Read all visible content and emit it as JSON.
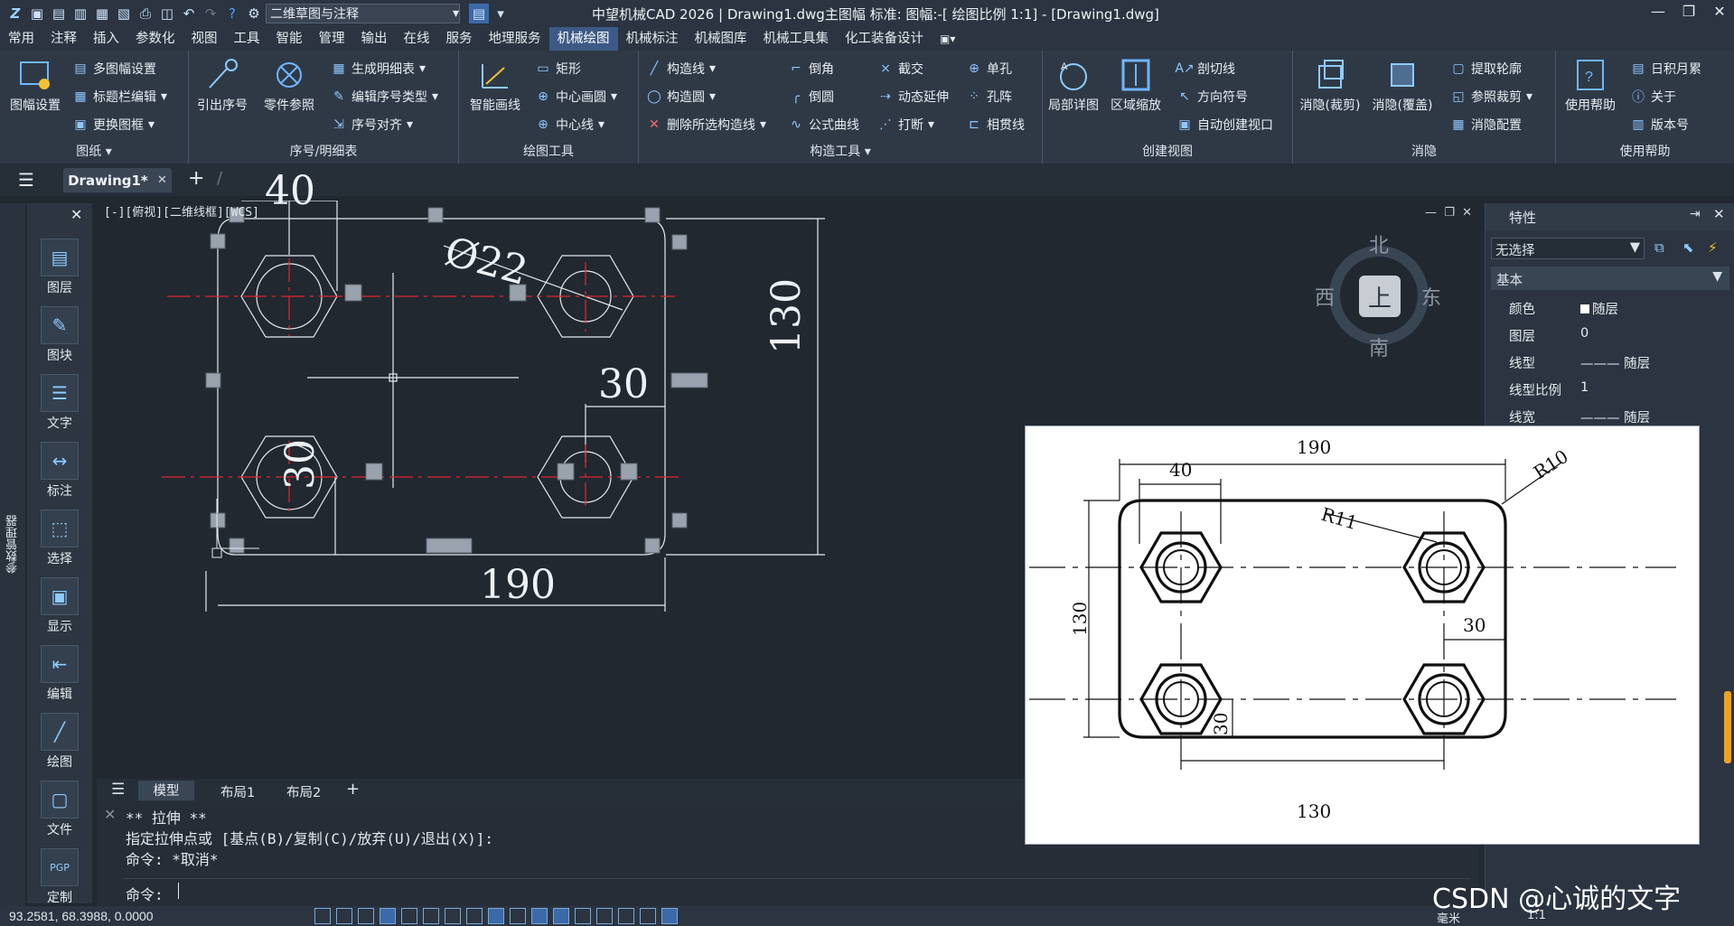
{
  "titlebar": {
    "workspace": "二维草图与注释",
    "app_title": "中望机械CAD 2026 | Drawing1.dwg主图幅  标准: 图幅:-[ 绘图比例 1:1] - [Drawing1.dwg]"
  },
  "menubar": [
    "常用",
    "注释",
    "插入",
    "参数化",
    "视图",
    "工具",
    "智能",
    "管理",
    "输出",
    "在线",
    "服务",
    "地理服务",
    "机械绘图",
    "机械标注",
    "机械图库",
    "机械工具集",
    "化工装备设计"
  ],
  "menubar_active": "机械绘图",
  "ribbon": {
    "panels": {
      "paper": "图纸",
      "seq": "序号/明细表",
      "draw": "绘图工具",
      "construct": "构造工具",
      "view": "创建视图",
      "hide": "消隐",
      "help": "使用帮助"
    },
    "buttons": {
      "paper_setup": "图幅设置",
      "multi_paper": "多图幅设置",
      "title_edit": "标题栏编辑",
      "change_frame": "更换图框",
      "lead_seq": "引出序号",
      "part_ref": "零件参照",
      "gen_bom": "生成明细表",
      "edit_seq_type": "编辑序号类型",
      "seq_align": "序号对齐",
      "smart_line": "智能画线",
      "rect": "矩形",
      "center_circle": "中心画圆",
      "center_line": "中心线",
      "cline": "构造线",
      "ccircle": "构造圆",
      "del_cline": "删除所选构造线",
      "chamfer": "倒角",
      "fillet": "倒圆",
      "formula_curve": "公式曲线",
      "cut_cross": "截交",
      "dyn_extend": "动态延伸",
      "break": "打断",
      "single_hole": "单孔",
      "hole_array": "孔阵",
      "thru_line": "相贯线",
      "section_line": "剖切线",
      "dir_symbol": "方向符号",
      "auto_viewport": "自动创建视口",
      "local_detail": "局部详图",
      "area_zoom": "区域缩放",
      "hide_clip": "消隐(裁剪)",
      "hide_cover": "消隐(覆盖)",
      "extract_outline": "提取轮廓",
      "ref_clip": "参照裁剪",
      "hide_config": "消隐配置",
      "use_help": "使用帮助",
      "daily_tips": "日积月累",
      "about": "关于",
      "version": "版本号"
    }
  },
  "doctab": {
    "name": "Drawing1*"
  },
  "left_palette": [
    "图层",
    "图块",
    "文字",
    "标注",
    "选择",
    "显示",
    "编辑",
    "绘图",
    "文件",
    "定制"
  ],
  "left_strip_label": "参数管理器",
  "view_label": "[-][俯视][二维线框][WCS]",
  "viewcube": {
    "n": "北",
    "s": "南",
    "e": "东",
    "w": "西",
    "top": "上"
  },
  "dims": {
    "w40": "40",
    "dia": "Ø22",
    "w30": "30",
    "h130": "130",
    "h30": "30",
    "w190": "190"
  },
  "properties": {
    "title": "特性",
    "selection": "无选择",
    "section": "基本",
    "rows": [
      {
        "k": "颜色",
        "v": "随层"
      },
      {
        "k": "图层",
        "v": "0"
      },
      {
        "k": "线型",
        "v": "——— 随层"
      },
      {
        "k": "线型比例",
        "v": "1"
      },
      {
        "k": "线宽",
        "v": "——— 随层"
      }
    ]
  },
  "layout_tabs": [
    "模型",
    "布局1",
    "布局2"
  ],
  "command": {
    "line1": "** 拉伸 **",
    "line2": "指定拉伸点或 [基点(B)/复制(C)/放弃(U)/退出(X)]:",
    "line3": "命令: *取消*",
    "prompt": "命令:"
  },
  "status": {
    "coords": "93.2581, 68.3988, 0.0000",
    "unit": "毫米",
    "scale": "1:1"
  },
  "reference": {
    "w190": "190",
    "w40": "40",
    "r10": "R10",
    "r11": "R11",
    "h130": "130",
    "w30": "30",
    "h30": "30",
    "w130": "130"
  },
  "watermark": "CSDN @心诚的文字"
}
